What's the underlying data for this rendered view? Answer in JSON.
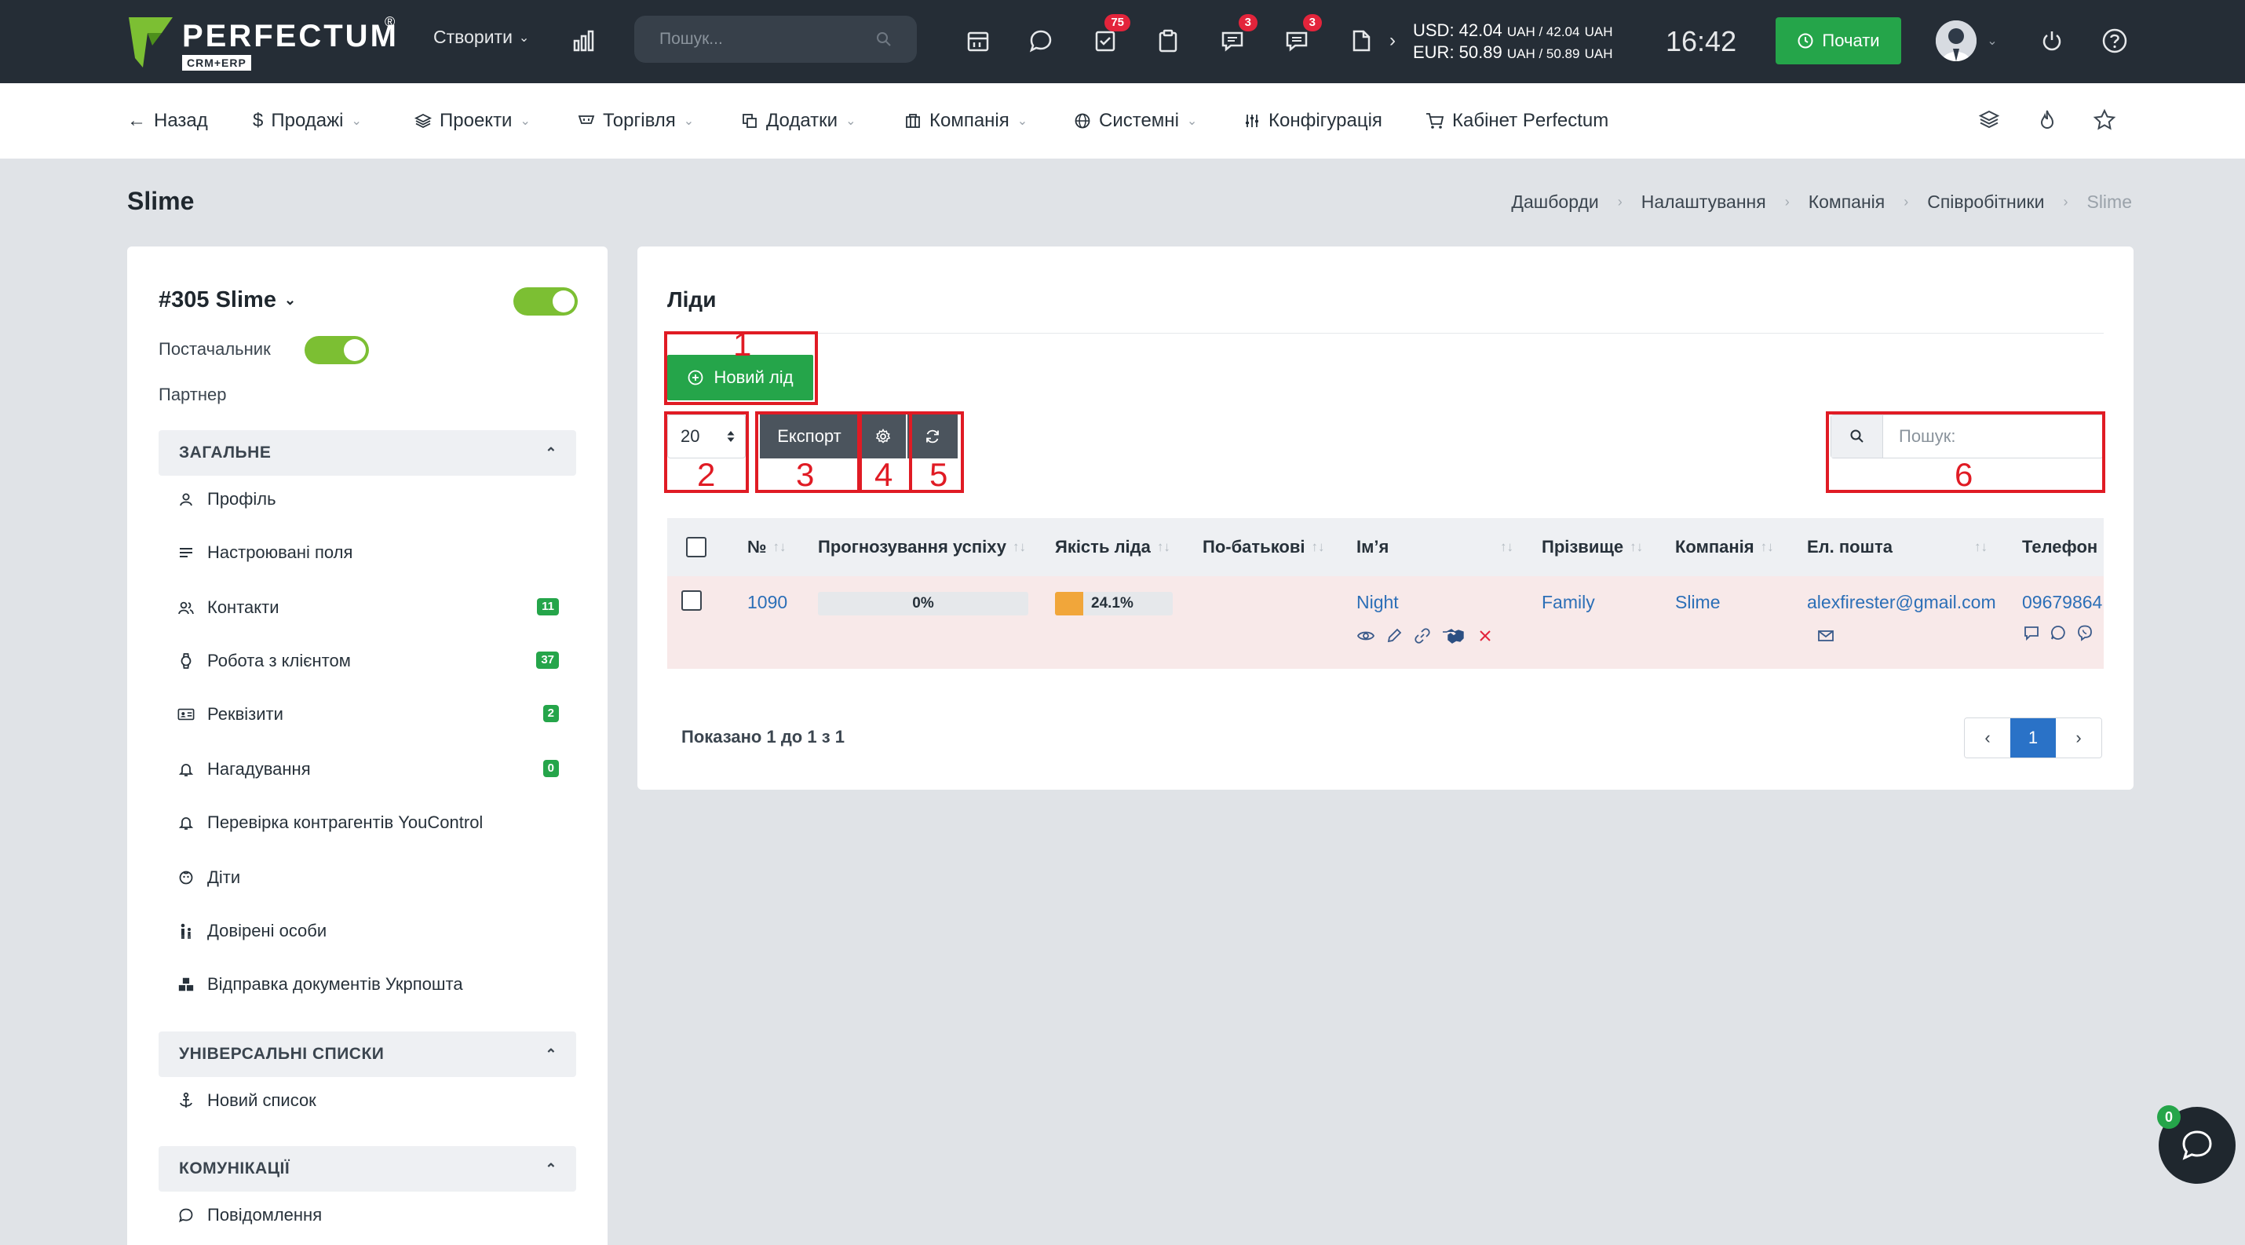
{
  "topbar": {
    "brand": "PERFECTUM",
    "brand_sub": "CRM+ERP",
    "brand_reg": "®",
    "create_label": "Створити",
    "search_placeholder": "Пошук...",
    "badges": {
      "tasks": "75",
      "messages": "3",
      "chat": "3"
    },
    "rate_usd": "USD: 42.04",
    "rate_usd_tail": "UAH / 42.04",
    "rate_usd_unit": "UAH",
    "rate_eur": "EUR: 50.89",
    "rate_eur_tail": "UAH / 50.89",
    "rate_eur_unit": "UAH",
    "time": "16:42",
    "start_label": "Почати"
  },
  "nav": {
    "back": "Назад",
    "sales": "Продажі",
    "projects": "Проекти",
    "trade": "Торгівля",
    "addons": "Додатки",
    "company": "Компанія",
    "system": "Системні",
    "config": "Конфігурація",
    "cabinet": "Кабінет Perfectum"
  },
  "page": {
    "title": "Slime",
    "breadcrumb": [
      "Дашборди",
      "Налаштування",
      "Компанія",
      "Співробітники",
      "Slime"
    ]
  },
  "employee": {
    "name": "#305 Slime",
    "supplier_label": "Постачальник",
    "partner_label": "Партнер",
    "sections": [
      {
        "title": "ЗАГАЛЬНЕ",
        "items": [
          {
            "label": "Профіль",
            "icon": "user-icon",
            "count": ""
          },
          {
            "label": "Настроювані поля",
            "icon": "list-icon",
            "count": ""
          },
          {
            "label": "Контакти",
            "icon": "users-icon",
            "count": "11"
          },
          {
            "label": "Робота з клієнтом",
            "icon": "watch-icon",
            "count": "37"
          },
          {
            "label": "Реквізити",
            "icon": "id-card-icon",
            "count": "2"
          },
          {
            "label": "Нагадування",
            "icon": "bell-icon",
            "count": "0"
          },
          {
            "label": "Перевірка контрагентів YouControl",
            "icon": "bell-icon",
            "count": ""
          },
          {
            "label": "Діти",
            "icon": "baby-icon",
            "count": ""
          },
          {
            "label": "Довірені особи",
            "icon": "people-icon",
            "count": ""
          },
          {
            "label": "Відправка документів Укрпошта",
            "icon": "boxes-icon",
            "count": ""
          }
        ]
      },
      {
        "title": "УНІВЕРСАЛЬНІ СПИСКИ",
        "items": [
          {
            "label": "Новий список",
            "icon": "anchor-icon",
            "count": ""
          }
        ]
      },
      {
        "title": "КОМУНІКАЦІЇ",
        "items": [
          {
            "label": "Повідомлення",
            "icon": "chat-icon",
            "count": ""
          }
        ]
      }
    ]
  },
  "leads": {
    "title": "Ліди",
    "new_lead": "Новий лід",
    "page_size": "20",
    "export": "Експорт",
    "search_placeholder": "Пошук:",
    "columns": [
      "№",
      "Прогнозування успіху",
      "Якість ліда",
      "По-батькові",
      "Ім’я",
      "Прізвище",
      "Компанія",
      "Ел. пошта",
      "Телефон"
    ],
    "rows": [
      {
        "id": "1090",
        "forecast": "0%",
        "quality": "24.1%",
        "quality_fraction": 0.241,
        "middle_name": "",
        "first_name": "Night",
        "last_name": "Family",
        "company": "Slime",
        "email": "alexfirester@gmail.com",
        "phone": "09679864"
      }
    ],
    "showing": "Показано 1 до 1 з 1",
    "pages": [
      "1"
    ]
  },
  "annotations": [
    "1",
    "2",
    "3",
    "4",
    "5",
    "6"
  ],
  "chat_badge": "0",
  "colors": {
    "accent": "#25a54a",
    "annotation": "#e01b24",
    "topbar": "#252d36",
    "pager_active": "#2a72c7",
    "row_bg": "#f8e9e9",
    "quality_fill": "#f1a63a"
  }
}
